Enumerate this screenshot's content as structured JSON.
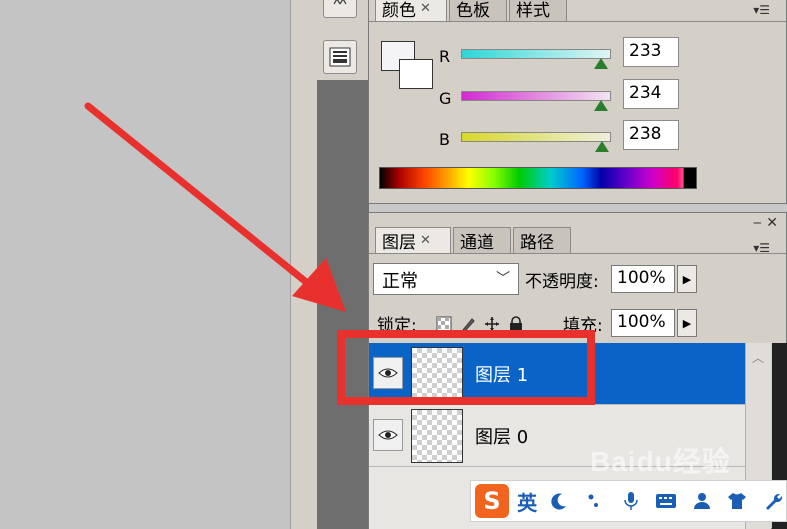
{
  "color_panel": {
    "tabs": [
      {
        "label": "颜色",
        "active": true,
        "closable": true
      },
      {
        "label": "色板",
        "active": false
      },
      {
        "label": "样式",
        "active": false
      }
    ],
    "channels": [
      {
        "label": "R",
        "value": "233"
      },
      {
        "label": "G",
        "value": "234"
      },
      {
        "label": "B",
        "value": "238"
      }
    ],
    "colors": {
      "R_slider": "#2ed6d6",
      "G_slider": "#d02ad0",
      "B_slider": "#d8d82a"
    }
  },
  "layers_panel": {
    "tabs": [
      {
        "label": "图层",
        "active": true,
        "closable": true
      },
      {
        "label": "通道",
        "active": false
      },
      {
        "label": "路径",
        "active": false
      }
    ],
    "blend_mode": "正常",
    "opacity_label": "不透明度:",
    "opacity_value": "100%",
    "lock_label": "锁定:",
    "fill_label": "填充:",
    "fill_value": "100%",
    "layers": [
      {
        "name": "图层 1",
        "selected": true,
        "visible": true
      },
      {
        "name": "图层 0",
        "selected": false,
        "visible": true
      }
    ],
    "colors": {
      "selection": "#0a64c8",
      "highlight": "#e8302c"
    }
  },
  "ime_toolbar": {
    "logo": "S",
    "lang": "英",
    "icons": [
      "moon-icon",
      "punctuation-icon",
      "microphone-icon",
      "keyboard-icon",
      "user-icon",
      "shirt-icon",
      "wrench-icon"
    ]
  },
  "watermark": "Baidu经验"
}
